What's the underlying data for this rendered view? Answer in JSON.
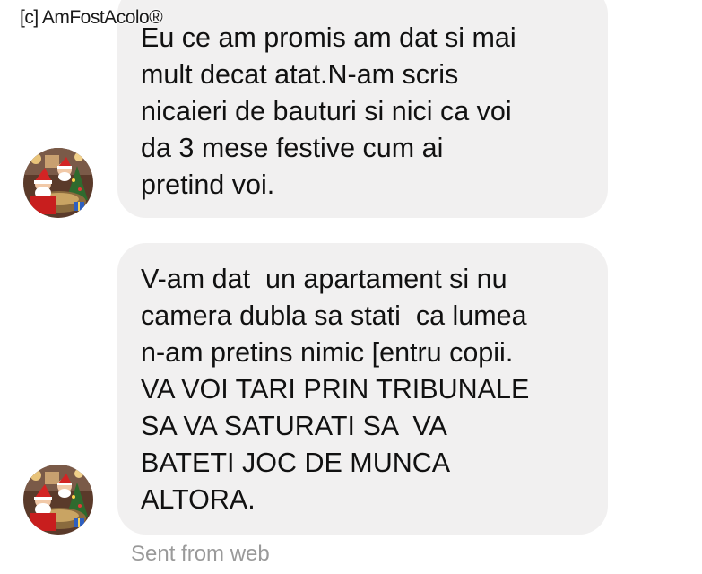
{
  "watermark": "[c] AmFostAcolo®",
  "messages": [
    {
      "lines": [
        "Eu ce am promis am dat si mai",
        "mult decat atat.N-am scris",
        "nicaieri de bauturi si nici ca voi",
        "da 3 mese festive cum ai",
        "pretind voi."
      ],
      "avatar": "santa-christmas-avatar"
    },
    {
      "lines": [
        "V-am dat  un apartament si nu",
        "camera dubla sa stati  ca lumea",
        "n-am pretins nimic [entru copii.",
        "VA VOI TARI PRIN TRIBUNALE",
        "SA VA SATURATI SA  VA",
        "BATETI JOC DE MUNCA",
        "ALTORA."
      ],
      "avatar": "santa-christmas-avatar"
    }
  ],
  "footer": {
    "sent_from": "Sent from web"
  },
  "colors": {
    "bubble": "#f1f0f0",
    "text": "#111111",
    "meta": "#9a9a9a"
  }
}
